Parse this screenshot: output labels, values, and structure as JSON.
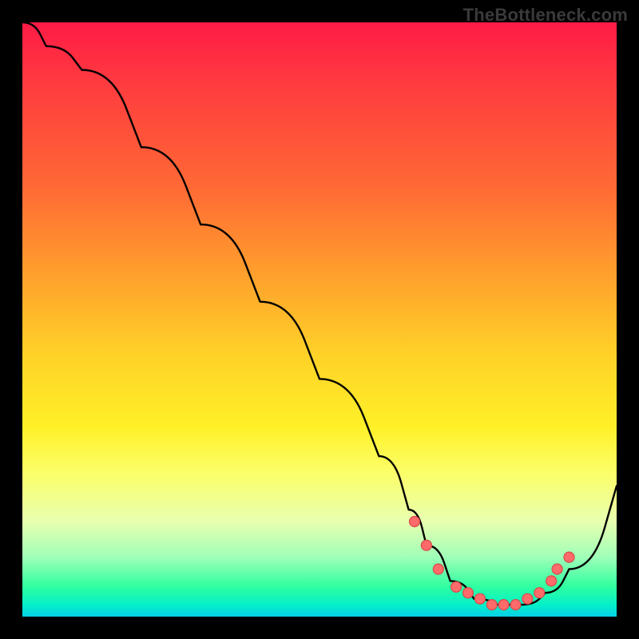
{
  "watermark": "TheBottleneck.com",
  "colors": {
    "frame": "#000000",
    "curve": "#000000",
    "dot_fill": "#ff6a6a",
    "dot_stroke": "#d74a4a"
  },
  "chart_data": {
    "type": "line",
    "title": "",
    "xlabel": "",
    "ylabel": "",
    "xlim": [
      0,
      100
    ],
    "ylim": [
      0,
      100
    ],
    "grid": false,
    "legend": false,
    "series": [
      {
        "name": "bottleneck-curve",
        "x": [
          0,
          4,
          10,
          20,
          30,
          40,
          50,
          60,
          65,
          68,
          72,
          76,
          80,
          84,
          88,
          92,
          100
        ],
        "y": [
          100,
          96,
          92,
          79,
          66,
          53,
          40,
          27,
          18,
          12,
          6,
          3,
          2,
          2,
          4,
          8,
          22
        ]
      }
    ],
    "markers": {
      "name": "highlight-dots",
      "x": [
        66,
        68,
        70,
        73,
        75,
        77,
        79,
        81,
        83,
        85,
        87,
        89,
        90,
        92
      ],
      "y": [
        16,
        12,
        8,
        5,
        4,
        3,
        2,
        2,
        2,
        3,
        4,
        6,
        8,
        10
      ]
    }
  }
}
